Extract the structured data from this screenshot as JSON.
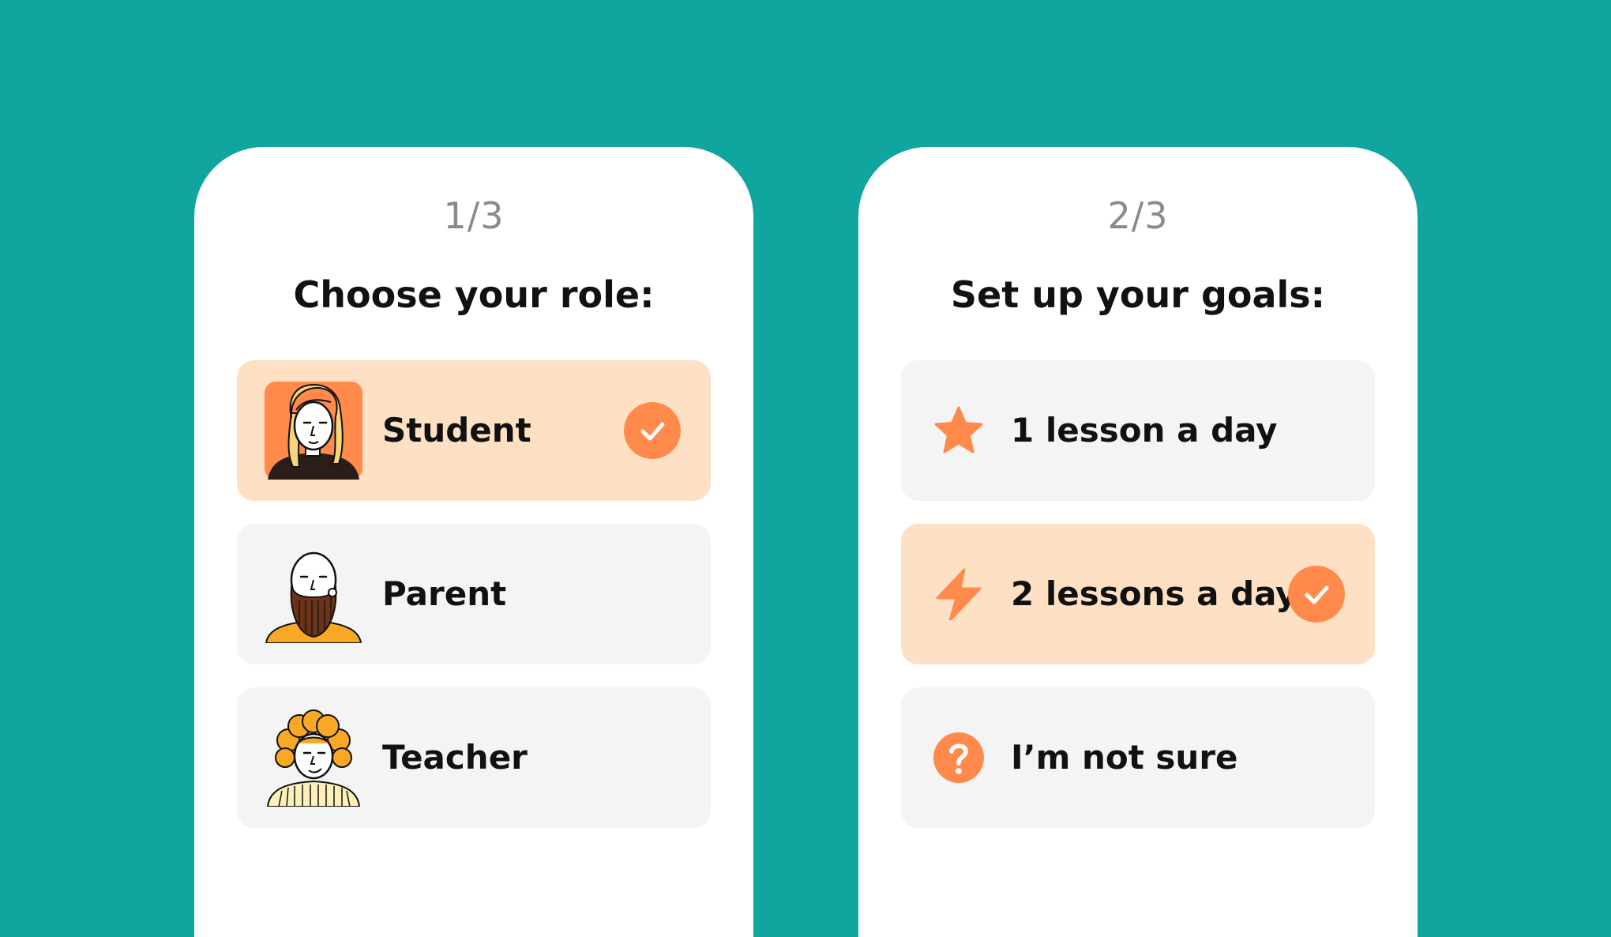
{
  "colors": {
    "background": "#10a59f",
    "card": "#ffffff",
    "option_default": "#f4f4f4",
    "option_selected": "#fee0c4",
    "accent": "#ff8a4c"
  },
  "role_screen": {
    "step": "1/3",
    "title": "Choose your role:",
    "options": [
      {
        "label": "Student",
        "avatar": "student-avatar",
        "selected": true
      },
      {
        "label": "Parent",
        "avatar": "parent-avatar",
        "selected": false
      },
      {
        "label": "Teacher",
        "avatar": "teacher-avatar",
        "selected": false
      }
    ]
  },
  "goals_screen": {
    "step": "2/3",
    "title": "Set up your goals:",
    "options": [
      {
        "label": "1 lesson a day",
        "icon": "star-icon",
        "selected": false
      },
      {
        "label": "2 lessons a day",
        "icon": "lightning-icon",
        "selected": true
      },
      {
        "label": "I’m not sure",
        "icon": "question-icon",
        "selected": false
      }
    ]
  }
}
